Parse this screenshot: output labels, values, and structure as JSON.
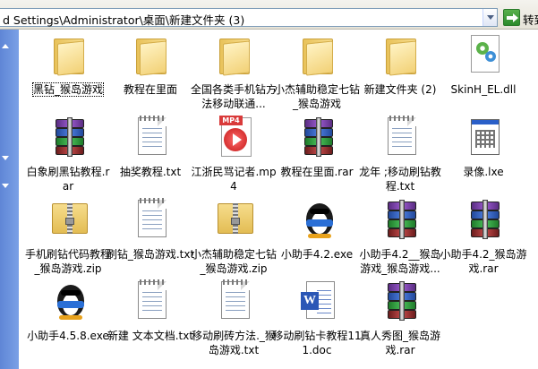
{
  "address_bar": {
    "path": "d Settings\\Administrator\\桌面\\新建文件夹 (3)",
    "go_label": "转到"
  },
  "items": [
    {
      "label": "黑钻_猴岛游戏",
      "type": "folder",
      "selected": true
    },
    {
      "label": "教程在里面",
      "type": "folder"
    },
    {
      "label": "全国各类手机钻方法移动联通...",
      "type": "folder"
    },
    {
      "label": "小杰辅助稳定七钻_猴岛游戏",
      "type": "folder"
    },
    {
      "label": "新建文件夹 (2)",
      "type": "folder"
    },
    {
      "label": "SkinH_EL.dll",
      "type": "dll"
    },
    {
      "label": "白象刷黑钻教程.rar",
      "type": "rar"
    },
    {
      "label": "抽奖教程.txt",
      "type": "txt"
    },
    {
      "label": "江浙民骂记者.mp4",
      "type": "mp4"
    },
    {
      "label": "教程在里面.rar",
      "type": "rar"
    },
    {
      "label": "龙年 ;移动刷钻教程.txt",
      "type": "txt"
    },
    {
      "label": "录像.lxe",
      "type": "lxe"
    },
    {
      "label": "手机刷钻代码教程_猴岛游戏.zip",
      "type": "zip"
    },
    {
      "label": "刷钻_猴岛游戏.txt",
      "type": "txt"
    },
    {
      "label": "小杰辅助稳定七钻_猴岛游戏.zip",
      "type": "zip"
    },
    {
      "label": "小助手4.2.exe",
      "type": "exe"
    },
    {
      "label": "小助手4.2__猴岛游戏_猴岛游戏...",
      "type": "rar"
    },
    {
      "label": "小助手4.2_猴岛游戏.rar",
      "type": "rar"
    },
    {
      "label": "小助手4.5.8.exe",
      "type": "exe"
    },
    {
      "label": "新建 文本文档.txt",
      "type": "txt"
    },
    {
      "label": "移动刷砖方法._猴岛游戏.txt",
      "type": "txt"
    },
    {
      "label": "移动刷钻卡教程111.doc",
      "type": "doc"
    },
    {
      "label": "真人秀图_猴岛游戏.rar",
      "type": "rar"
    }
  ]
}
